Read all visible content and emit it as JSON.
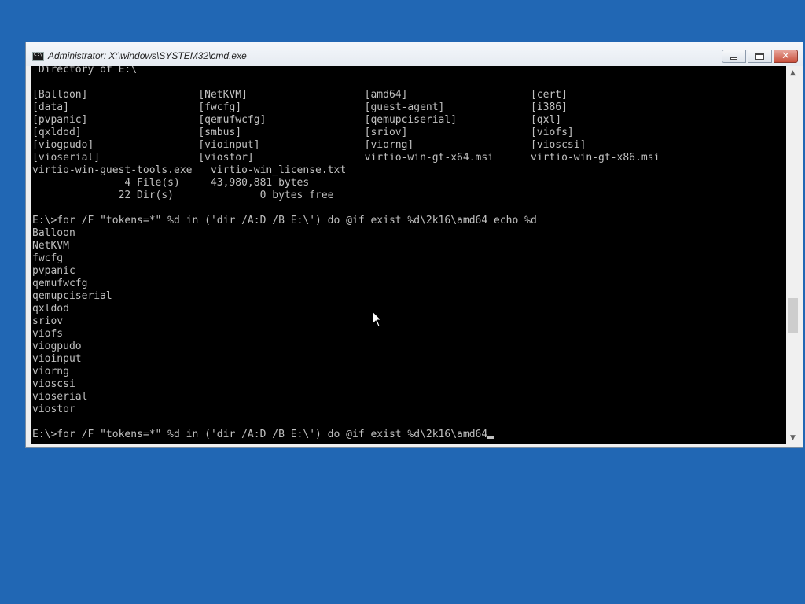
{
  "window": {
    "title": "Administrator: X:\\windows\\SYSTEM32\\cmd.exe",
    "icon": "cmd-console-icon"
  },
  "caption_buttons": {
    "minimize_icon": "minimize-icon",
    "maximize_icon": "maximize-icon",
    "close_icon": "close-icon",
    "close_glyph": "✕"
  },
  "console": {
    "background": "#000000",
    "foreground": "#c0c0c0",
    "lines": [
      " Directory of E:\\",
      "",
      "[Balloon]                  [NetKVM]                   [amd64]                    [cert]",
      "[data]                     [fwcfg]                    [guest-agent]              [i386]",
      "[pvpanic]                  [qemufwcfg]                [qemupciserial]            [qxl]",
      "[qxldod]                   [smbus]                    [sriov]                    [viofs]",
      "[viogpudo]                 [vioinput]                 [viorng]                   [vioscsi]",
      "[vioserial]                [viostor]                  virtio-win-gt-x64.msi      virtio-win-gt-x86.msi",
      "virtio-win-guest-tools.exe   virtio-win_license.txt",
      "               4 File(s)     43,980,881 bytes",
      "              22 Dir(s)              0 bytes free",
      "",
      "E:\\>for /F \"tokens=*\" %d in ('dir /A:D /B E:\\') do @if exist %d\\2k16\\amd64 echo %d",
      "Balloon",
      "NetKVM",
      "fwcfg",
      "pvpanic",
      "qemufwcfg",
      "qemupciserial",
      "qxldod",
      "sriov",
      "viofs",
      "viogpudo",
      "vioinput",
      "viorng",
      "vioscsi",
      "vioserial",
      "viostor",
      ""
    ],
    "prompt_line": "E:\\>for /F \"tokens=*\" %d in ('dir /A:D /B E:\\') do @if exist %d\\2k16\\amd64"
  },
  "scrollbar": {
    "up_arrow": "▲",
    "down_arrow": "▼",
    "up_icon": "scroll-up-arrow-icon",
    "down_icon": "scroll-down-arrow-icon"
  },
  "desktop": {
    "background": "#2167b4"
  }
}
